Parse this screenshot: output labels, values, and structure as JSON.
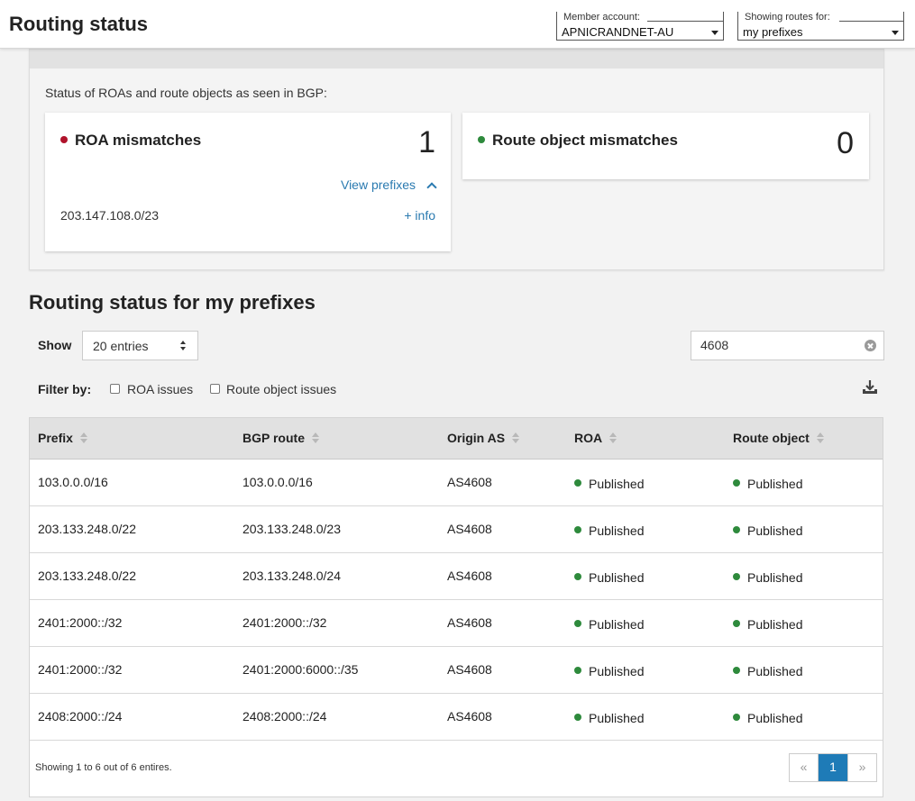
{
  "header": {
    "title": "Routing status",
    "member_account": {
      "label": "Member account:",
      "value": "APNICRANDNET-AU"
    },
    "showing_routes": {
      "label": "Showing routes for:",
      "value": "my prefixes"
    }
  },
  "summary": {
    "description": "Status of ROAs and route objects as seen in BGP:",
    "roa_card": {
      "title": "ROA mismatches",
      "count": "1",
      "view_label": "View prefixes",
      "prefix": "203.147.108.0/23",
      "info_label": "+ info",
      "status_color": "#b0132b"
    },
    "route_card": {
      "title": "Route object mismatches",
      "count": "0",
      "status_color": "#2e8a3c"
    }
  },
  "section_title": "Routing status for my prefixes",
  "controls": {
    "show_label": "Show",
    "entries_value": "20 entries",
    "search_value": "4608",
    "filter_label": "Filter by:",
    "filter_roa": "ROA issues",
    "filter_route": "Route object issues"
  },
  "table": {
    "columns": [
      "Prefix",
      "BGP route",
      "Origin AS",
      "ROA",
      "Route object"
    ],
    "rows": [
      {
        "prefix": "103.0.0.0/16",
        "bgp": "103.0.0.0/16",
        "origin": "AS4608",
        "roa": "Published",
        "route": "Published"
      },
      {
        "prefix": "203.133.248.0/22",
        "bgp": "203.133.248.0/23",
        "origin": "AS4608",
        "roa": "Published",
        "route": "Published"
      },
      {
        "prefix": "203.133.248.0/22",
        "bgp": "203.133.248.0/24",
        "origin": "AS4608",
        "roa": "Published",
        "route": "Published"
      },
      {
        "prefix": "2401:2000::/32",
        "bgp": "2401:2000::/32",
        "origin": "AS4608",
        "roa": "Published",
        "route": "Published"
      },
      {
        "prefix": "2401:2000::/32",
        "bgp": "2401:2000:6000::/35",
        "origin": "AS4608",
        "roa": "Published",
        "route": "Published"
      },
      {
        "prefix": "2408:2000::/24",
        "bgp": "2408:2000::/24",
        "origin": "AS4608",
        "roa": "Published",
        "route": "Published"
      }
    ],
    "footer_text": "Showing 1 to 6 out of 6 entires.",
    "pagination": {
      "prev": "«",
      "current": "1",
      "next": "»"
    }
  }
}
